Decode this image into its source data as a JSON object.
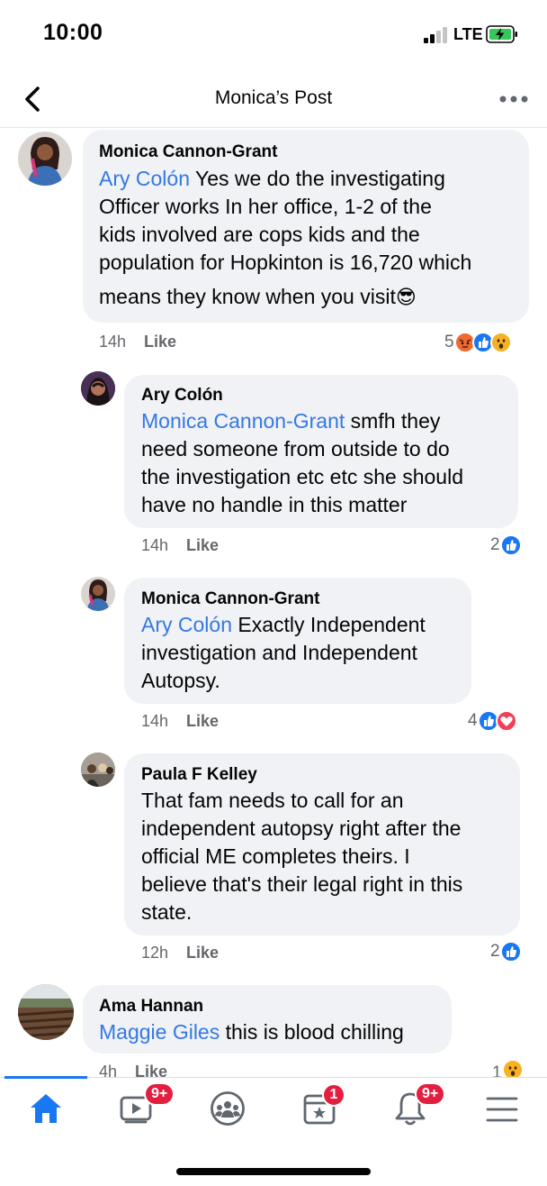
{
  "status_bar": {
    "time": "10:00",
    "network": "LTE"
  },
  "header": {
    "title": "Monica’s Post"
  },
  "comments": [
    {
      "author": "Monica Cannon-Grant",
      "mention": "Ary Colón",
      "lines": [
        " Yes we do the investigating",
        "Officer works In her office, 1-2 of the",
        "kids involved are cops kids and the",
        "population for Hopkinton is 16,720 which",
        "means they know when you visit"
      ],
      "emoji": "😎",
      "time": "14h",
      "like": "Like",
      "reaction_count": "5",
      "reactions": [
        "angry",
        "like",
        "wow"
      ]
    },
    {
      "author": "Ary Colón",
      "mention": "Monica Cannon-Grant",
      "lines": [
        " smfh they",
        "need someone from outside to do",
        "the investigation etc etc she should",
        "have no handle in this matter"
      ],
      "time": "14h",
      "like": "Like",
      "reaction_count": "2",
      "reactions": [
        "like"
      ]
    },
    {
      "author": "Monica Cannon-Grant",
      "mention": "Ary Colón",
      "lines": [
        " Exactly Independent",
        "investigation and Independent",
        "Autopsy."
      ],
      "time": "14h",
      "like": "Like",
      "reaction_count": "4",
      "reactions": [
        "like",
        "love"
      ]
    },
    {
      "author": "Paula F Kelley",
      "lines": [
        "That fam needs to call for an",
        "independent autopsy right after the",
        "official ME completes theirs. I",
        "believe that's their legal right in this",
        "state."
      ],
      "time": "12h",
      "like": "Like",
      "reaction_count": "2",
      "reactions": [
        "like"
      ]
    },
    {
      "author": "Ama Hannan",
      "mention": "Maggie Giles",
      "lines": [
        " this is blood chilling"
      ],
      "time": "4h",
      "like": "Like",
      "reaction_count": "1",
      "reactions": [
        "wow"
      ]
    }
  ],
  "tab_bar": {
    "tabs": [
      {
        "icon": "home-icon",
        "active": true
      },
      {
        "icon": "watch-icon",
        "badge": "9+"
      },
      {
        "icon": "groups-icon"
      },
      {
        "icon": "pages-icon",
        "badge": "1"
      },
      {
        "icon": "notifications-icon",
        "badge": "9+"
      },
      {
        "icon": "menu-icon"
      }
    ]
  },
  "colors": {
    "accent": "#1877f2",
    "mention": "#3578e5",
    "bubble": "#f0f2f5",
    "badge": "#e41e3f"
  }
}
